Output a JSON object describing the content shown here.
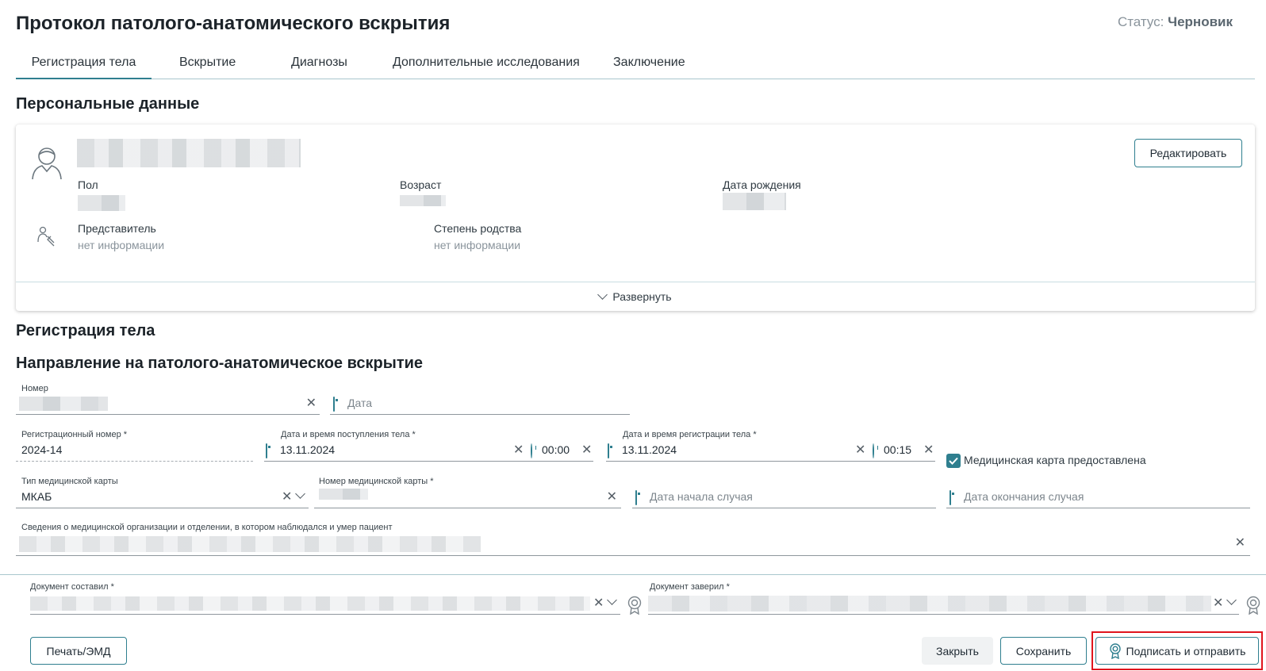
{
  "header": {
    "title": "Протокол патолого-анатомического вскрытия",
    "status_label": "Статус:",
    "status_value": "Черновик"
  },
  "tabs": [
    {
      "label": "Регистрация тела",
      "active": true
    },
    {
      "label": "Вскрытие"
    },
    {
      "label": "Диагнозы"
    },
    {
      "label": "Дополнительные исследования"
    },
    {
      "label": "Заключение"
    }
  ],
  "personal": {
    "section_title": "Персональные данные",
    "edit_label": "Редактировать",
    "sex_label": "Пол",
    "age_label": "Возраст",
    "birth_label": "Дата рождения",
    "rep_label": "Представитель",
    "rep_value": "нет информации",
    "kin_label": "Степень родства",
    "kin_value": "нет информации",
    "expand_label": "Развернуть"
  },
  "body_reg": {
    "section_title": "Регистрация тела",
    "referral_title": "Направление на патолого-анатомическое вскрытие",
    "number_label": "Номер",
    "date_placeholder": "Дата",
    "reg_number_label": "Регистрационный номер *",
    "reg_number_value": "2024-14",
    "arrival_label": "Дата и время поступления тела *",
    "arrival_date": "13.11.2024",
    "arrival_time": "00:00",
    "registration_label": "Дата и время регистрации тела *",
    "registration_date": "13.11.2024",
    "registration_time": "00:15",
    "medcard_provided_label": "Медицинская карта предоставлена",
    "medcard_provided": true,
    "card_type_label": "Тип медицинской карты",
    "card_type_value": "МКАБ",
    "card_number_label": "Номер медицинской карты *",
    "case_start_placeholder": "Дата начала случая",
    "case_end_placeholder": "Дата окончания случая",
    "org_info_label": "Сведения о медицинской организации и отделении, в котором наблюдался и умер пациент"
  },
  "footer": {
    "composed_label": "Документ составил *",
    "certified_label": "Документ заверил *",
    "print_label": "Печать/ЭМД",
    "close_label": "Закрыть",
    "save_label": "Сохранить",
    "sign_label": "Подписать и отправить"
  },
  "colors": {
    "accent": "#2f7f8f",
    "highlight": "#e0151d"
  }
}
